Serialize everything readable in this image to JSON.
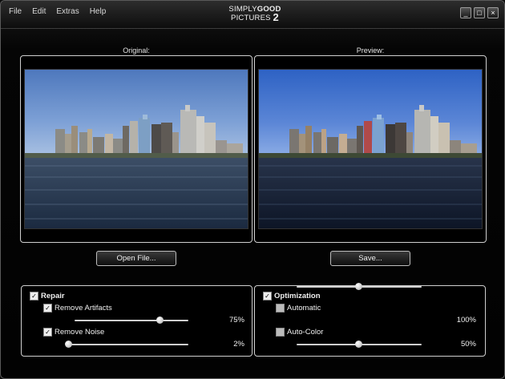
{
  "menu": [
    "File",
    "Edit",
    "Extras",
    "Help"
  ],
  "logo": {
    "line1a": "SIMPLY",
    "line1b": "GOOD",
    "line2": "PICTURES",
    "num": "2"
  },
  "window_controls": {
    "minimize": "_",
    "maximize": "□",
    "close": "×"
  },
  "original": {
    "label": "Original:"
  },
  "preview": {
    "label": "Preview:"
  },
  "buttons": {
    "open": "Open File...",
    "save": "Save..."
  },
  "repair": {
    "title": "Repair",
    "checked": true,
    "artifacts": {
      "label": "Remove Artifacts",
      "checked": true,
      "value": 0.75,
      "text": "75%"
    },
    "noise": {
      "label": "Remove Noise",
      "checked": true,
      "value": 0.02,
      "text": "2%"
    }
  },
  "optimization": {
    "title": "Optimization",
    "checked": true,
    "automatic": {
      "label": "Automatic",
      "checked": false,
      "value": 0.5,
      "text": "100%"
    },
    "autocolor": {
      "label": "Auto-Color",
      "checked": false,
      "value": 0.5,
      "text": "50%"
    }
  }
}
